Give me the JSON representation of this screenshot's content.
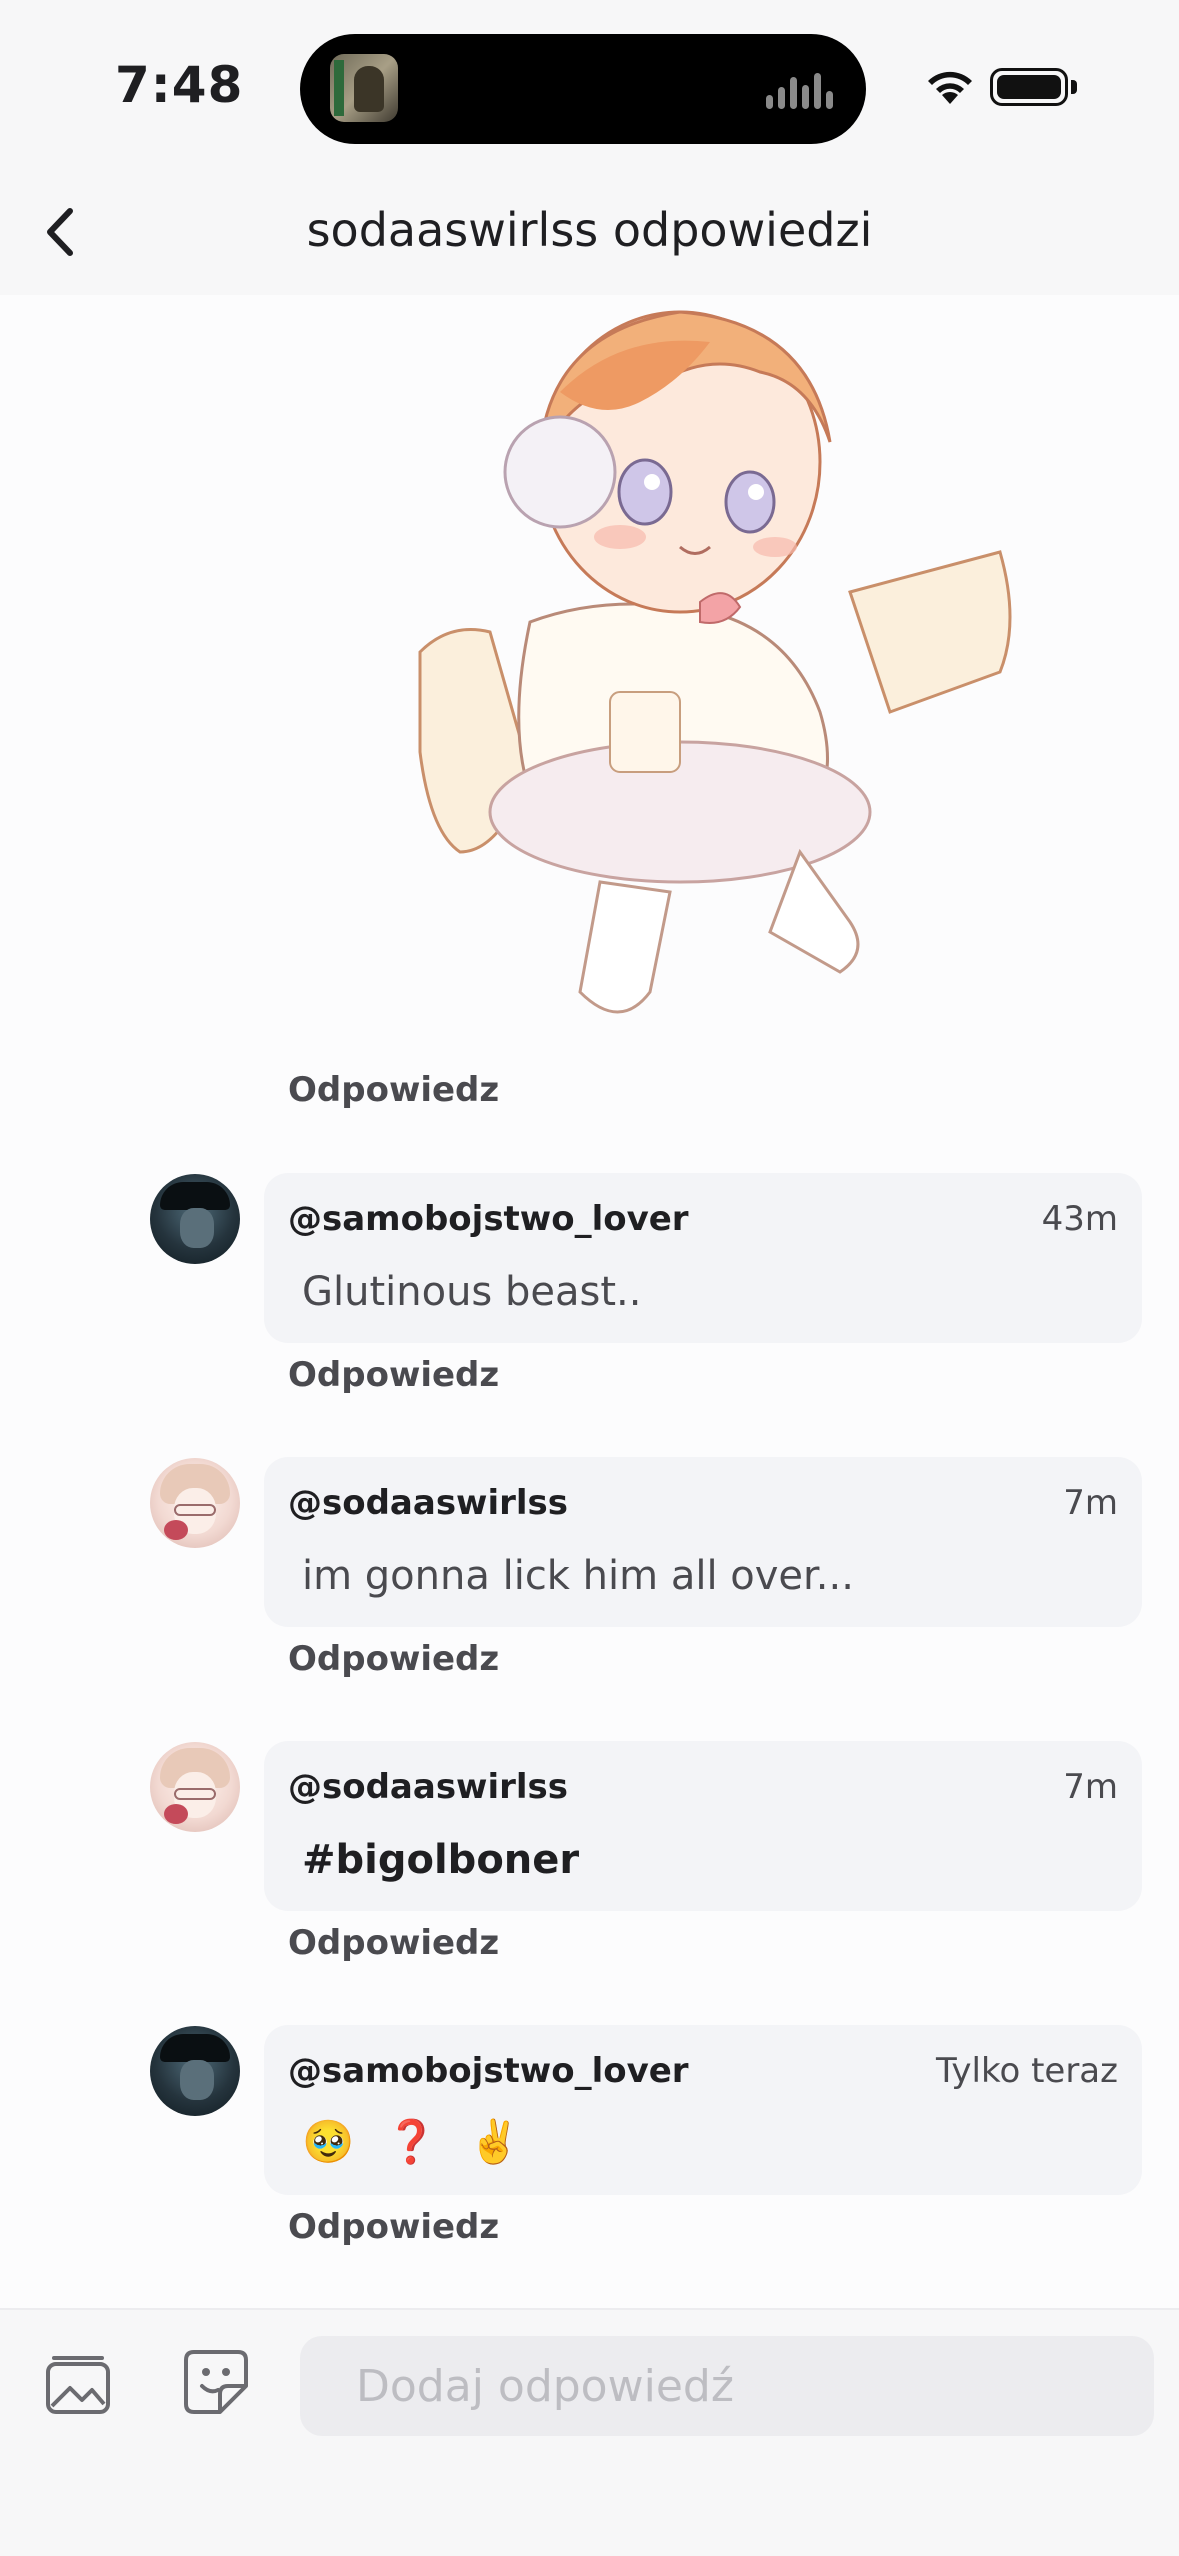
{
  "status_bar": {
    "time": "7:48"
  },
  "header": {
    "title": "sodaaswirlss odpowiedzi"
  },
  "post": {
    "reply_label": "Odpowiedz"
  },
  "comments": [
    {
      "username": "@samobojstwo_lover",
      "time": "43m",
      "text": "Glutinous beast..",
      "reply_label": "Odpowiedz"
    },
    {
      "username": "@sodaaswirlss",
      "time": "7m",
      "text": "im gonna lick him all over...",
      "reply_label": "Odpowiedz"
    },
    {
      "username": "@sodaaswirlss",
      "time": "7m",
      "text": "#bigolboner",
      "reply_label": "Odpowiedz"
    },
    {
      "username": "@samobojstwo_lover",
      "time": "Tylko teraz",
      "emojis": [
        "🥹",
        "❓",
        "✌️"
      ],
      "reply_label": "Odpowiedz"
    }
  ],
  "composer": {
    "placeholder": "Dodaj odpowiedź"
  },
  "icons": [
    "back-icon",
    "image-icon",
    "sticker-icon",
    "wifi-icon",
    "battery-icon"
  ]
}
